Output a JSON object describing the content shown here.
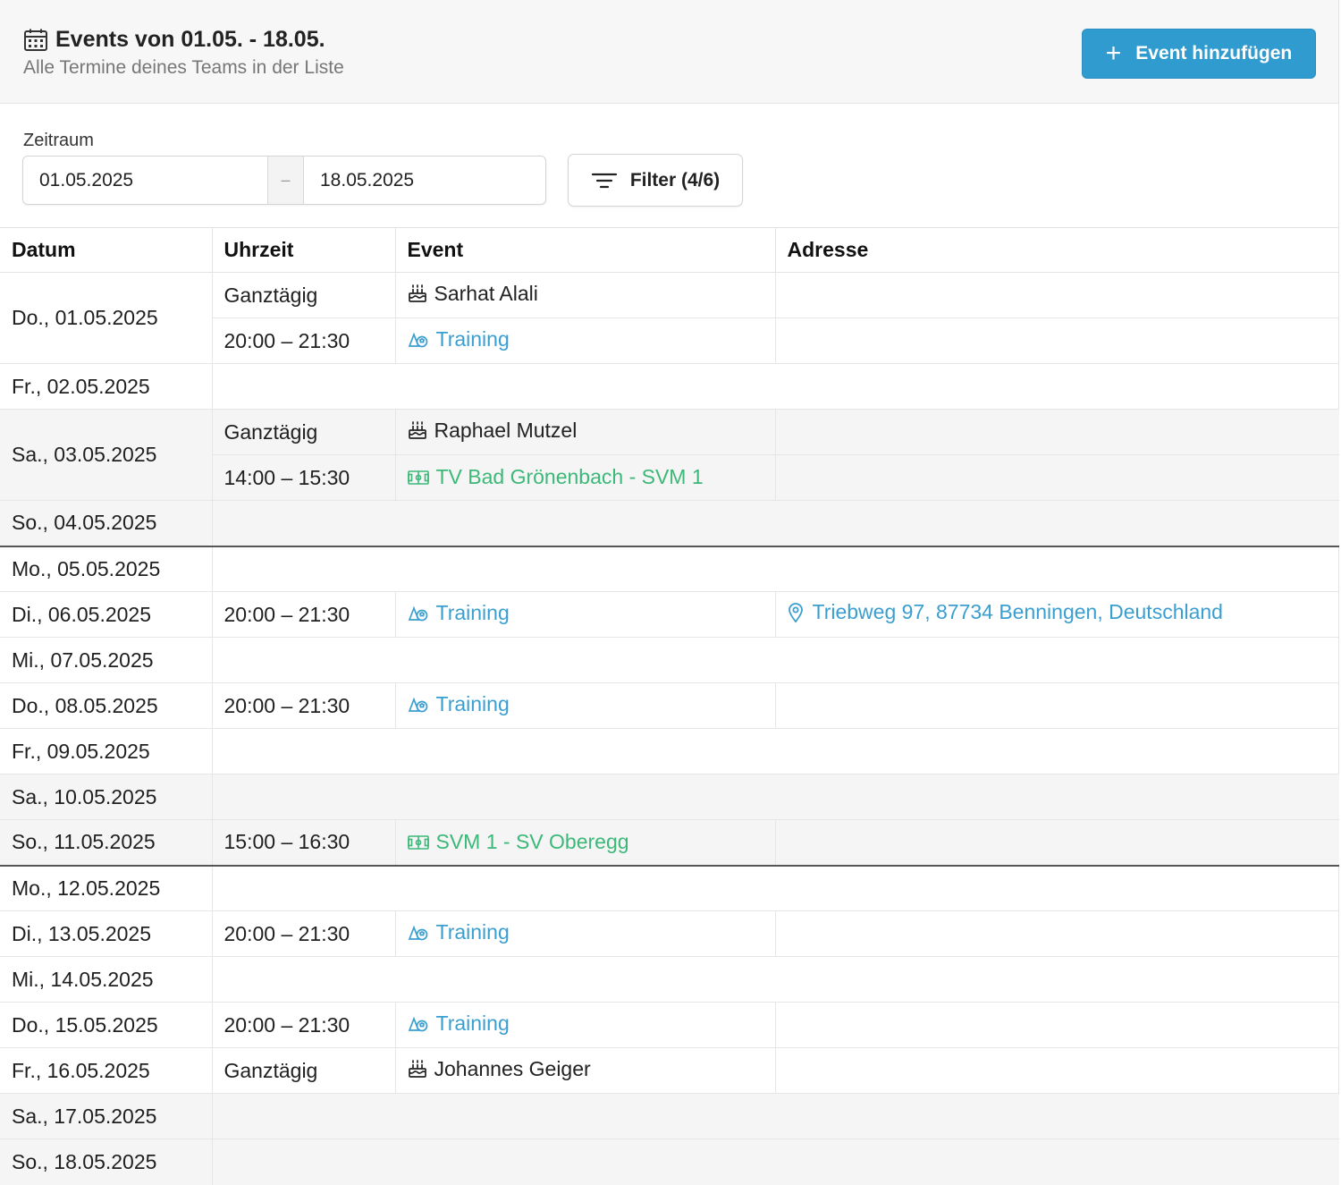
{
  "header": {
    "title": "Events von 01.05. - 18.05.",
    "subtitle": "Alle Termine deines Teams in der Liste",
    "add_button": "Event hinzufügen"
  },
  "toolbar": {
    "range_label": "Zeitraum",
    "from": "01.05.2025",
    "separator": "–",
    "to": "18.05.2025",
    "filter_label": "Filter (4/6)"
  },
  "table": {
    "headers": [
      "Datum",
      "Uhrzeit",
      "Event",
      "Adresse"
    ],
    "days": [
      {
        "date": "Do., 01.05.2025",
        "weekend": false,
        "events": [
          {
            "time": "Ganztägig",
            "type": "birthday",
            "title": "Sarhat Alali",
            "address": ""
          },
          {
            "time": "20:00 – 21:30",
            "type": "training",
            "title": "Training",
            "address": ""
          }
        ]
      },
      {
        "date": "Fr., 02.05.2025",
        "weekend": false,
        "events": []
      },
      {
        "date": "Sa., 03.05.2025",
        "weekend": true,
        "events": [
          {
            "time": "Ganztägig",
            "type": "birthday",
            "title": "Raphael Mutzel",
            "address": ""
          },
          {
            "time": "14:00 – 15:30",
            "type": "game",
            "title": "TV Bad Grönenbach - SVM 1",
            "address": ""
          }
        ]
      },
      {
        "date": "So., 04.05.2025",
        "weekend": true,
        "events": []
      },
      {
        "date": "Mo., 05.05.2025",
        "weekend": false,
        "week_start": true,
        "events": []
      },
      {
        "date": "Di., 06.05.2025",
        "weekend": false,
        "events": [
          {
            "time": "20:00 – 21:30",
            "type": "training",
            "title": "Training",
            "address": "Triebweg 97, 87734 Benningen, Deutschland"
          }
        ]
      },
      {
        "date": "Mi., 07.05.2025",
        "weekend": false,
        "events": []
      },
      {
        "date": "Do., 08.05.2025",
        "weekend": false,
        "events": [
          {
            "time": "20:00 – 21:30",
            "type": "training",
            "title": "Training",
            "address": ""
          }
        ]
      },
      {
        "date": "Fr., 09.05.2025",
        "weekend": false,
        "events": []
      },
      {
        "date": "Sa., 10.05.2025",
        "weekend": true,
        "events": []
      },
      {
        "date": "So., 11.05.2025",
        "weekend": true,
        "events": [
          {
            "time": "15:00 – 16:30",
            "type": "game",
            "title": "SVM 1 - SV Oberegg",
            "address": ""
          }
        ]
      },
      {
        "date": "Mo., 12.05.2025",
        "weekend": false,
        "week_start": true,
        "events": []
      },
      {
        "date": "Di., 13.05.2025",
        "weekend": false,
        "events": [
          {
            "time": "20:00 – 21:30",
            "type": "training",
            "title": "Training",
            "address": ""
          }
        ]
      },
      {
        "date": "Mi., 14.05.2025",
        "weekend": false,
        "events": []
      },
      {
        "date": "Do., 15.05.2025",
        "weekend": false,
        "events": [
          {
            "time": "20:00 – 21:30",
            "type": "training",
            "title": "Training",
            "address": ""
          }
        ]
      },
      {
        "date": "Fr., 16.05.2025",
        "weekend": false,
        "events": [
          {
            "time": "Ganztägig",
            "type": "birthday",
            "title": "Johannes Geiger",
            "address": ""
          }
        ]
      },
      {
        "date": "Sa., 17.05.2025",
        "weekend": true,
        "events": []
      },
      {
        "date": "So., 18.05.2025",
        "weekend": true,
        "events": []
      }
    ]
  },
  "icons": {
    "header": "calendar-icon",
    "add": "plus-icon",
    "filter": "filter-lines-icon",
    "birthday": "cake-icon",
    "training": "whistle-icon",
    "game": "ticket-icon",
    "address": "map-pin-icon"
  },
  "colors": {
    "accent": "#2f9bcf",
    "training": "#3a9fd0",
    "game": "#3cb878",
    "weekend_bg": "#f5f5f5",
    "week_divider": "#555555"
  }
}
